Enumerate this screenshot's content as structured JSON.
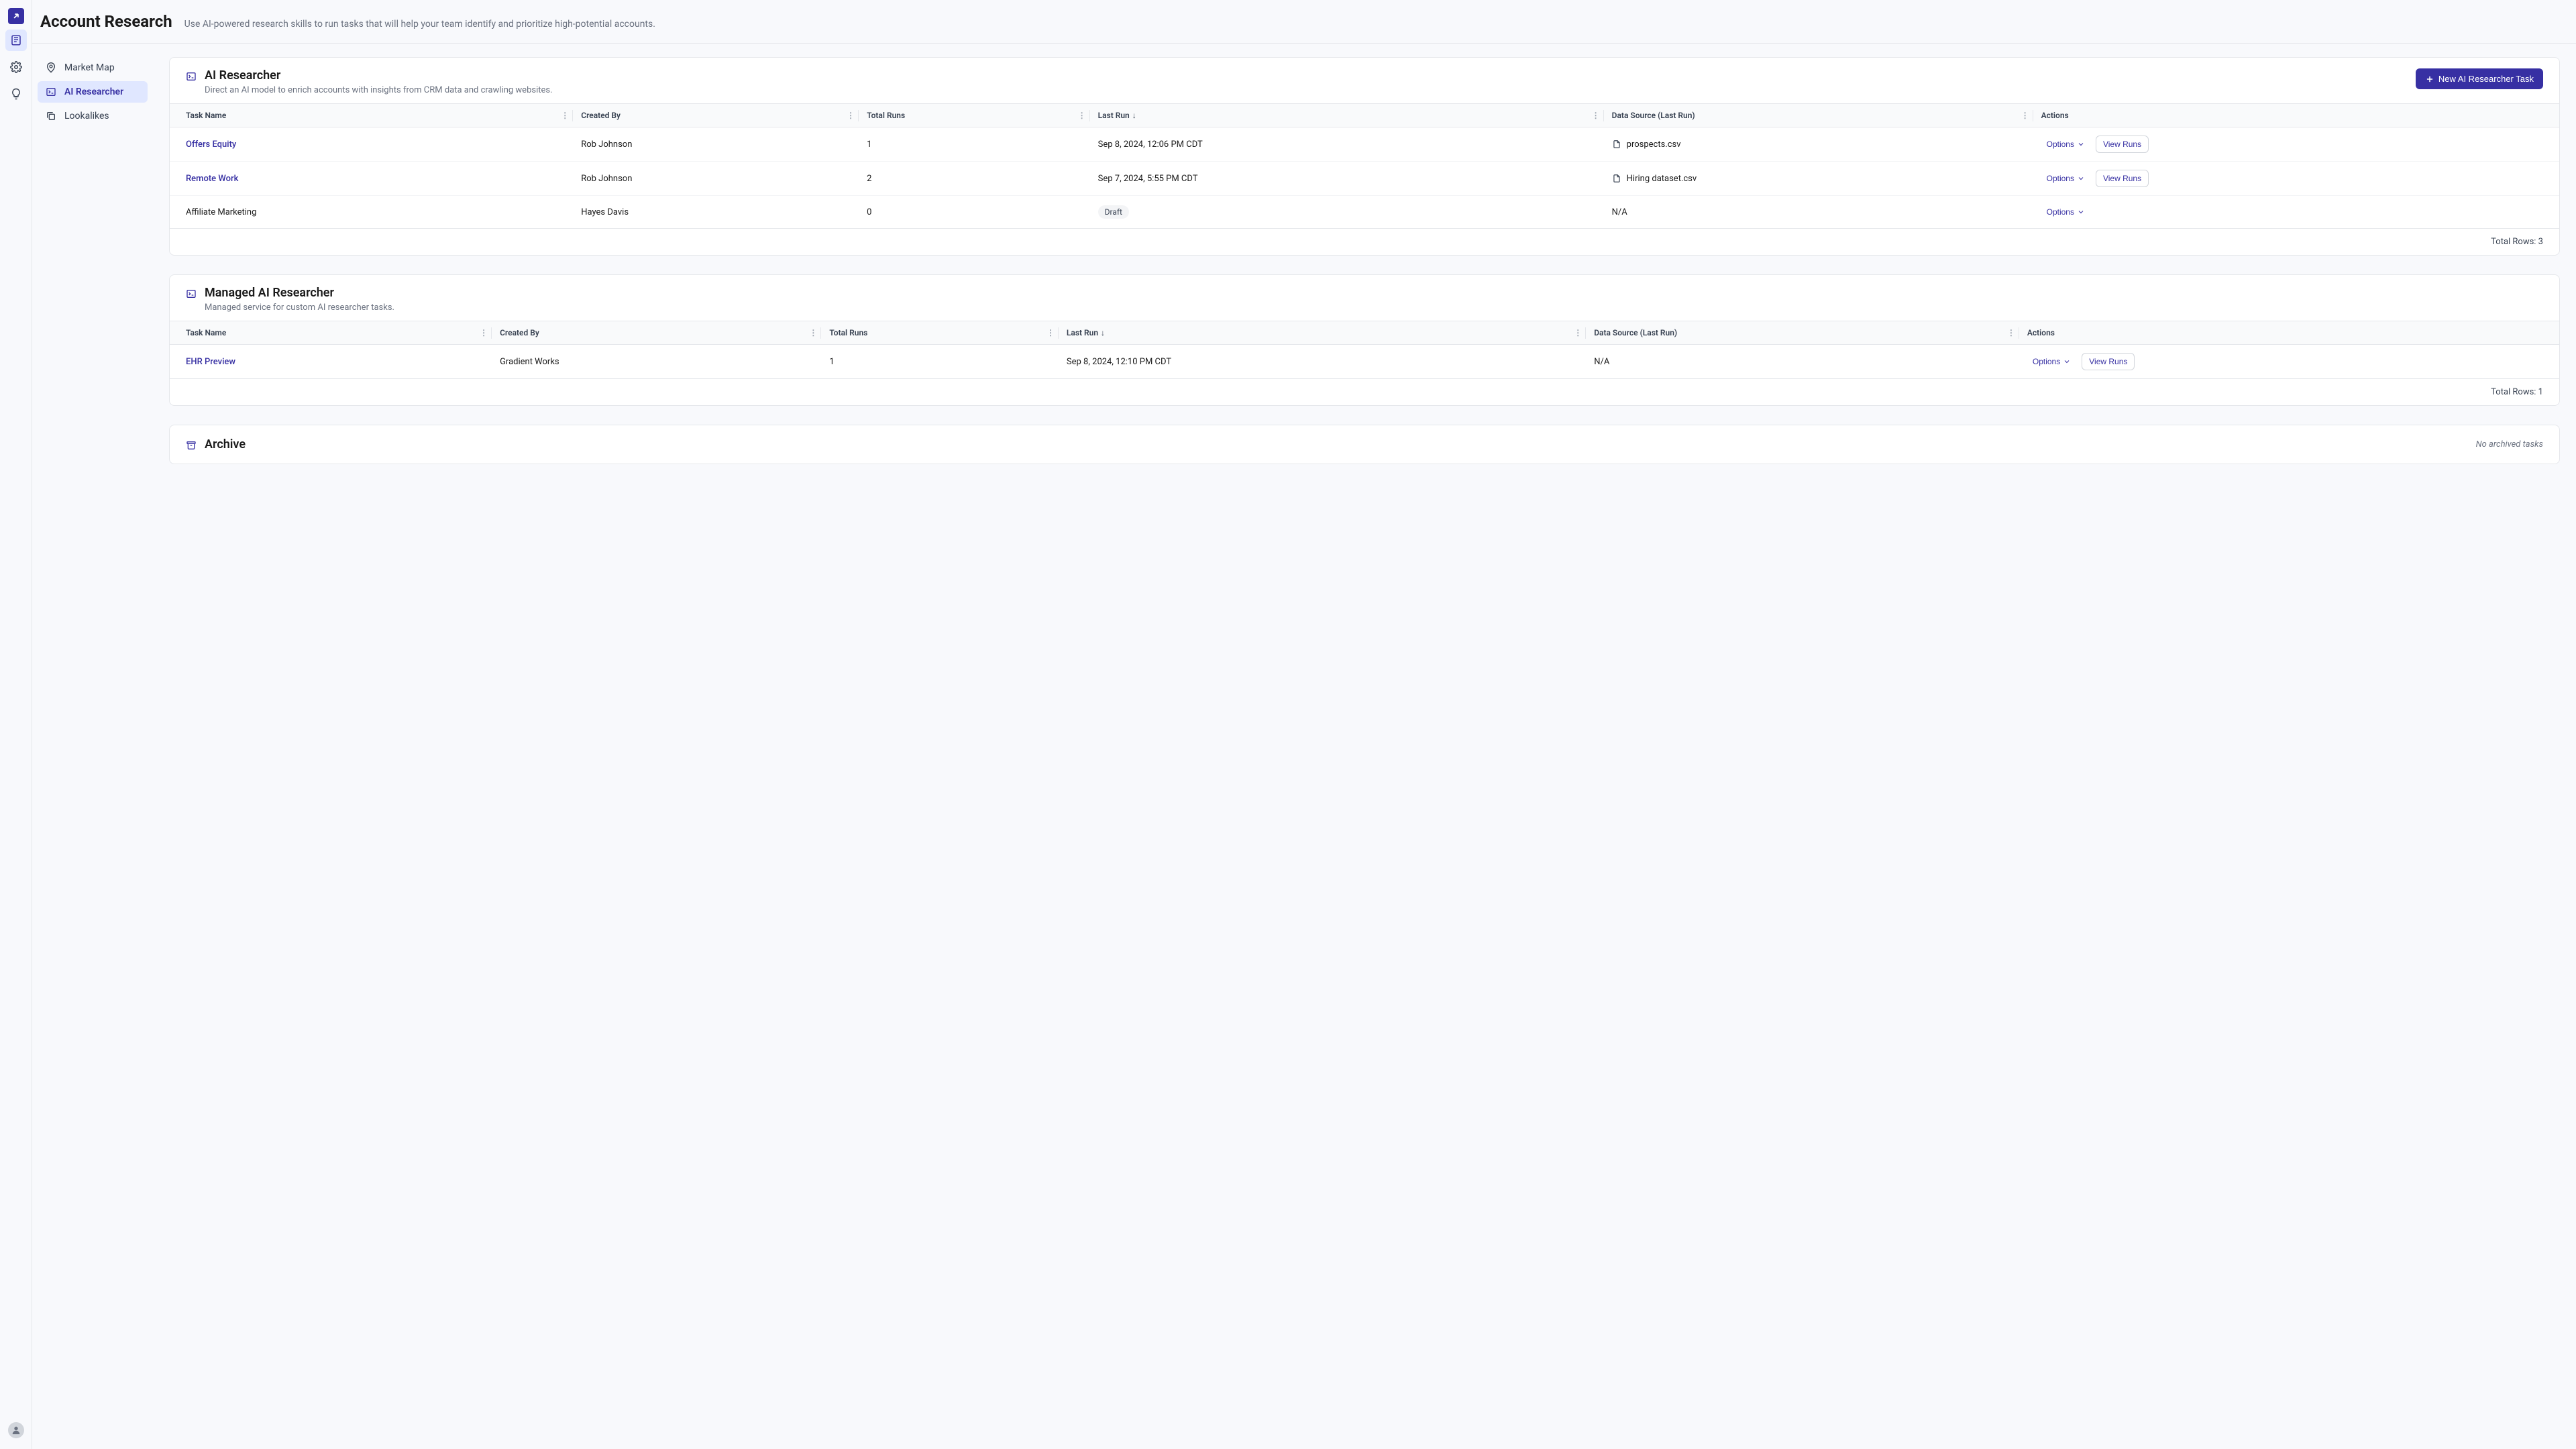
{
  "header": {
    "title": "Account Research",
    "subtitle": "Use AI-powered research skills to run tasks that will help your team identify and prioritize high-potential accounts."
  },
  "sidebar": {
    "items": [
      {
        "label": "Market Map",
        "icon": "pin"
      },
      {
        "label": "AI Researcher",
        "icon": "terminal",
        "active": true
      },
      {
        "label": "Lookalikes",
        "icon": "copy"
      }
    ]
  },
  "sections": {
    "ai_researcher": {
      "title": "AI Researcher",
      "subtitle": "Direct an AI model to enrich accounts with insights from CRM data and crawling websites.",
      "new_button": "New AI Researcher Task",
      "columns": [
        "Task Name",
        "Created By",
        "Total Runs",
        "Last Run",
        "Data Source (Last Run)",
        "Actions"
      ],
      "rows": [
        {
          "task": "Offers Equity",
          "task_link": true,
          "created_by": "Rob Johnson",
          "total_runs": "1",
          "last_run": "Sep 8, 2024, 12:06 PM CDT",
          "data_source": "prospects.csv",
          "has_view": true
        },
        {
          "task": "Remote Work",
          "task_link": true,
          "created_by": "Rob Johnson",
          "total_runs": "2",
          "last_run": "Sep 7, 2024, 5:55 PM CDT",
          "data_source": "Hiring dataset.csv",
          "has_view": true
        },
        {
          "task": "Affiliate Marketing",
          "task_link": false,
          "created_by": "Hayes Davis",
          "total_runs": "0",
          "last_run_badge": "Draft",
          "data_source": "N/A",
          "has_view": false
        }
      ],
      "footer": "Total Rows: 3"
    },
    "managed": {
      "title": "Managed AI Researcher",
      "subtitle": "Managed service for custom AI researcher tasks.",
      "columns": [
        "Task Name",
        "Created By",
        "Total Runs",
        "Last Run",
        "Data Source (Last Run)",
        "Actions"
      ],
      "rows": [
        {
          "task": "EHR Preview",
          "task_link": true,
          "created_by": "Gradient Works",
          "total_runs": "1",
          "last_run": "Sep 8, 2024, 12:10 PM CDT",
          "data_source": "N/A",
          "has_view": true
        }
      ],
      "footer": "Total Rows: 1"
    },
    "archive": {
      "title": "Archive",
      "empty": "No archived tasks"
    }
  },
  "labels": {
    "options": "Options",
    "view_runs": "View Runs"
  }
}
